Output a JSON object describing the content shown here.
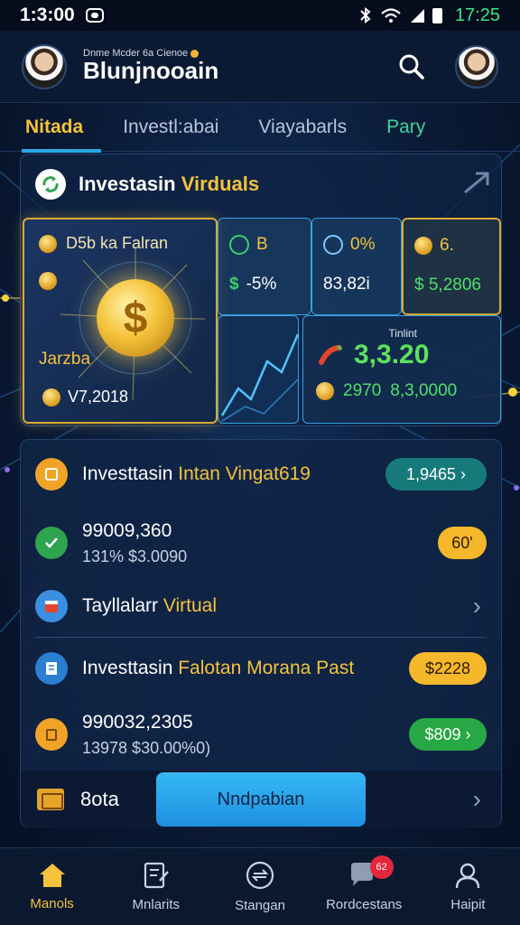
{
  "status_bar": {
    "time": "1:3:00",
    "clock": "17:25"
  },
  "header": {
    "subtitle": "Dnme Mcder 6a Cienoe",
    "title": "Blunjnooain"
  },
  "tabs": [
    {
      "label": "Nitada"
    },
    {
      "label": "Investl:abai"
    },
    {
      "label": "Viayabarls"
    },
    {
      "label": "Pary"
    }
  ],
  "hero": {
    "title_white": "Investasin",
    "title_gold": "Virduals",
    "main_tile": {
      "top_label": "D5b ka Falran",
      "label": "Jarzba",
      "value": "V7,2018"
    },
    "tile_b": {
      "top": "B",
      "bottom": "-5%"
    },
    "tile_c": {
      "top": "0%",
      "bottom": "83,82i"
    },
    "tile_d": {
      "top": "6.",
      "bottom": "$ 5,2806"
    },
    "tile_e": {
      "label": "Tinlint",
      "value": "3,3.20",
      "sub_a": "2970",
      "sub_b": "8,3,0000"
    }
  },
  "list": {
    "row1": {
      "title_white": "Investtasin",
      "title_gold": "Intan Vingat619",
      "pill": "1,9465"
    },
    "row2": {
      "main": "99009,360",
      "sub": "131% $3.0090",
      "pill": "60'"
    },
    "row3": {
      "title_white": "Tayllalarr",
      "title_gold": "Virtual"
    },
    "row4": {
      "title_white": "Investtasin",
      "title_gold": "Falotan Morana Past",
      "pill": "$2228"
    },
    "row5": {
      "main": "990032,2305",
      "sub": "13978 $30.00%0)",
      "pill": "$809"
    },
    "bottom": {
      "label": "8ota",
      "button": "Nndpabian"
    }
  },
  "bottom_nav": [
    {
      "label": "Manols",
      "icon": "home-icon",
      "active": true
    },
    {
      "label": "Mnlarits",
      "icon": "document-edit-icon"
    },
    {
      "label": "Stangan",
      "icon": "exchange-icon"
    },
    {
      "label": "Rordcestans",
      "icon": "chat-icon",
      "badge": "62"
    },
    {
      "label": "Haipit",
      "icon": "person-icon"
    }
  ],
  "colors": {
    "accent_gold": "#f5c23c",
    "accent_blue": "#2aa8e6",
    "positive_green": "#3ecf6a"
  }
}
